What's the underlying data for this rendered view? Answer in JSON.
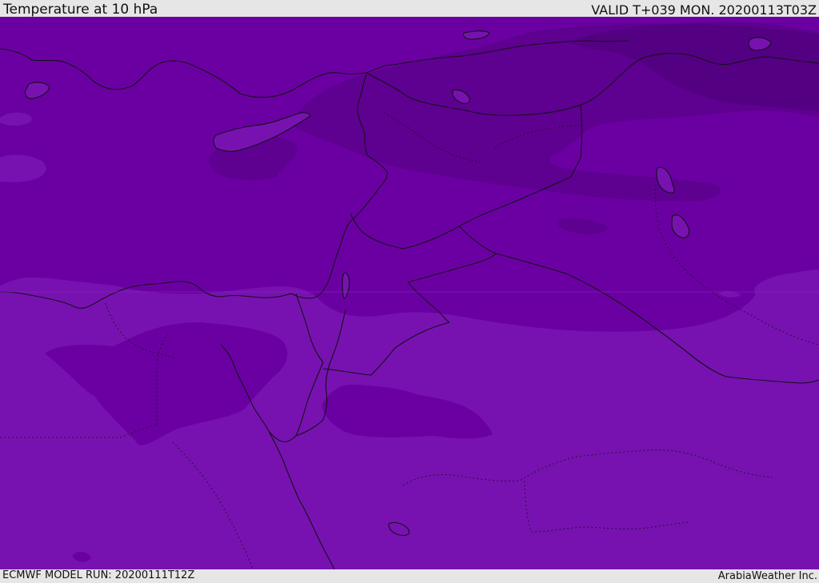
{
  "header": {
    "title": "Temperature at 10 hPa",
    "valid": "VALID T+039 MON. 20200113T03Z"
  },
  "map": {
    "base_color": "#7712b0",
    "mid_color": "#6b00a2",
    "dark_color": "#5e0090",
    "darkest_color": "#540083",
    "line_color": "#141018"
  },
  "footer": {
    "model_run": "ECMWF MODEL RUN: 20200111T12Z",
    "brand": "ArabiaWeather Inc."
  }
}
